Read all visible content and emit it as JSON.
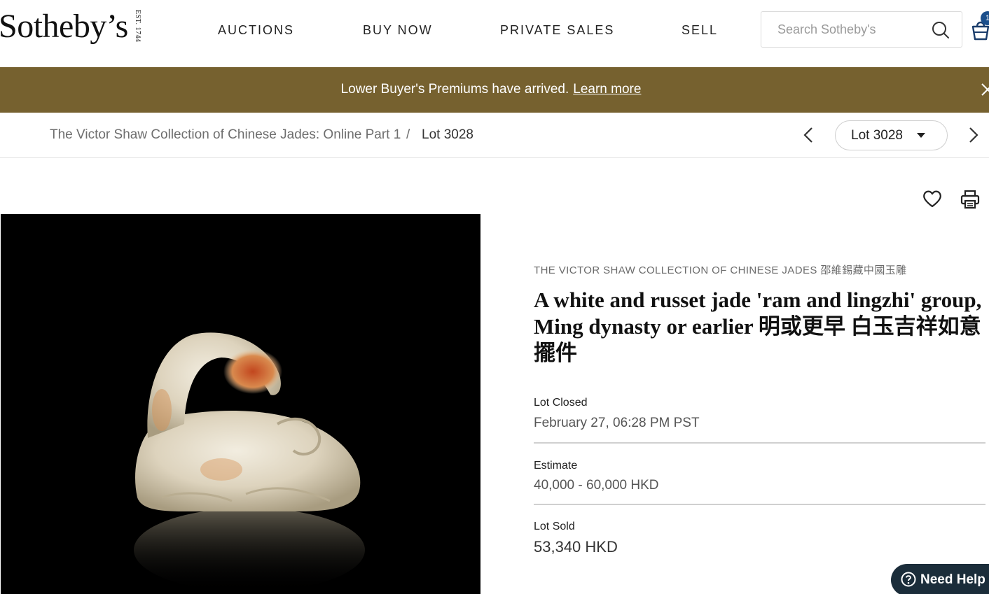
{
  "header": {
    "logo_text": "Sotheby’s",
    "logo_est": "EST. 1744",
    "nav": [
      {
        "label": "AUCTIONS"
      },
      {
        "label": "BUY NOW"
      },
      {
        "label": "PRIVATE SALES"
      },
      {
        "label": "SELL"
      }
    ],
    "search_placeholder": "Search Sotheby's",
    "cart_count": "1"
  },
  "banner": {
    "text": "Lower Buyer's Premiums have arrived.",
    "link": "Learn more"
  },
  "breadcrumb": {
    "parent": "The Victor Shaw Collection of Chinese Jades: Online Part 1",
    "separator": "/",
    "current": "Lot 3028"
  },
  "lot_nav": {
    "selected": "Lot 3028"
  },
  "lot": {
    "collection": "THE VICTOR SHAW COLLECTION OF CHINESE JADES 邵維錫藏中國玉雕",
    "title": "A white and russet jade 'ram and lingzhi' group, Ming dynasty or earlier 明或更早 白玉吉祥如意擺件",
    "status_label": "Lot Closed",
    "status_value": "February 27, 06:28 PM PST",
    "estimate_label": "Estimate",
    "estimate_value": "40,000 - 60,000 HKD",
    "sold_label": "Lot Sold",
    "sold_value": "53,340 HKD"
  },
  "help": {
    "label": "Need Help"
  },
  "colors": {
    "banner": "#76612f",
    "help_button": "#1b2d3a",
    "badge": "#1b4f8c"
  }
}
